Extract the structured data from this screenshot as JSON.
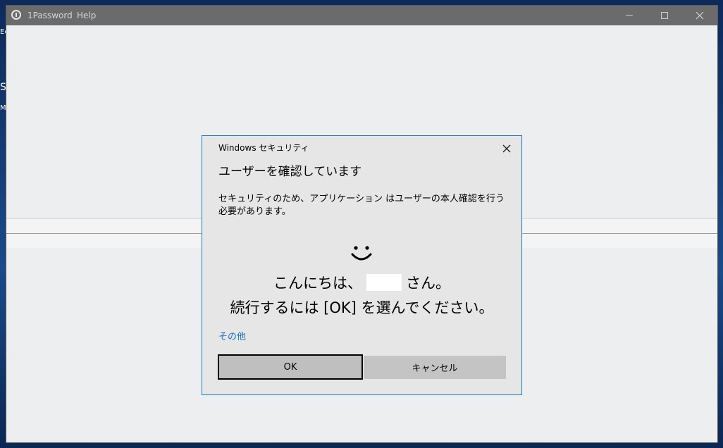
{
  "desktop": {
    "fragments": [
      "Ec",
      "S",
      "Mi"
    ]
  },
  "app": {
    "title": "1Password",
    "menu": [
      "1Password",
      "Help"
    ],
    "controls": [
      "minimize-icon",
      "maximize-icon",
      "close-icon"
    ]
  },
  "dialog": {
    "title": "Windows セキュリティ",
    "heading": "ユーザーを確認しています",
    "message": "セキュリティのため、アプリケーション はユーザーの本人確認を行う必要があります。",
    "icon": "smile-icon",
    "greeting_prefix": "こんにちは、",
    "greeting_suffix": "さん。",
    "instruction": "続行するには [OK] を選んでください。",
    "more_link": "その他",
    "ok_label": "OK",
    "cancel_label": "キャンセル",
    "accent_color": "#1f7bd6",
    "link_color": "#1a6fc9"
  }
}
